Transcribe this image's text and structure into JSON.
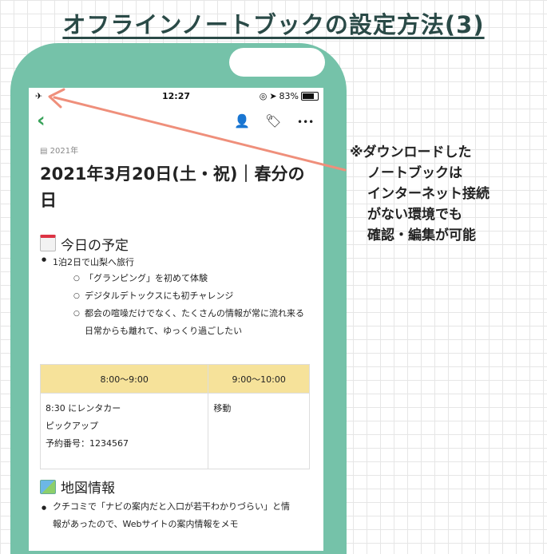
{
  "title": "オフラインノートブックの設定方法(3)",
  "status": {
    "time": "12:27",
    "battery": "83%"
  },
  "toolbar": {
    "back": "<",
    "more": "•••"
  },
  "note": {
    "notebook": "2021年",
    "title": "2021年3月20日(土・祝)｜春分の日",
    "section1": "今日の予定",
    "item1": "1泊2日で山梨へ旅行",
    "sub1": "「グランピング」を初めて体験",
    "sub2": "デジタルデトックスにも初チャレンジ",
    "sub3": "都会の喧噪だけでなく、たくさんの情報が常に流れ来る日常からも離れて、ゆっくり過ごしたい",
    "table": {
      "headers": [
        "8:00〜9:00",
        "9:00〜10:00"
      ],
      "cell1": [
        "8:30 にレンタカー",
        "ピックアップ",
        "予約番号：1234567"
      ],
      "cell2": "移動"
    },
    "section2": "地図情報",
    "item2": "クチコミで「ナビの案内だと入口が若干わかりづらい」と情報があったので、Webサイトの案内情報をメモ"
  },
  "callout": [
    "※ダウンロードした",
    "ノートブックは",
    "インターネット接続",
    "がない環境でも",
    "確認・編集が可能"
  ],
  "colors": {
    "phone": "#75c2a9",
    "accent": "#3aa35b",
    "arrow": "#ef8f7b",
    "table_header": "#f6e29a"
  },
  "icons": [
    "airplane-icon",
    "back-chevron-icon",
    "add-user-icon",
    "pin-tag-icon",
    "more-icon"
  ]
}
